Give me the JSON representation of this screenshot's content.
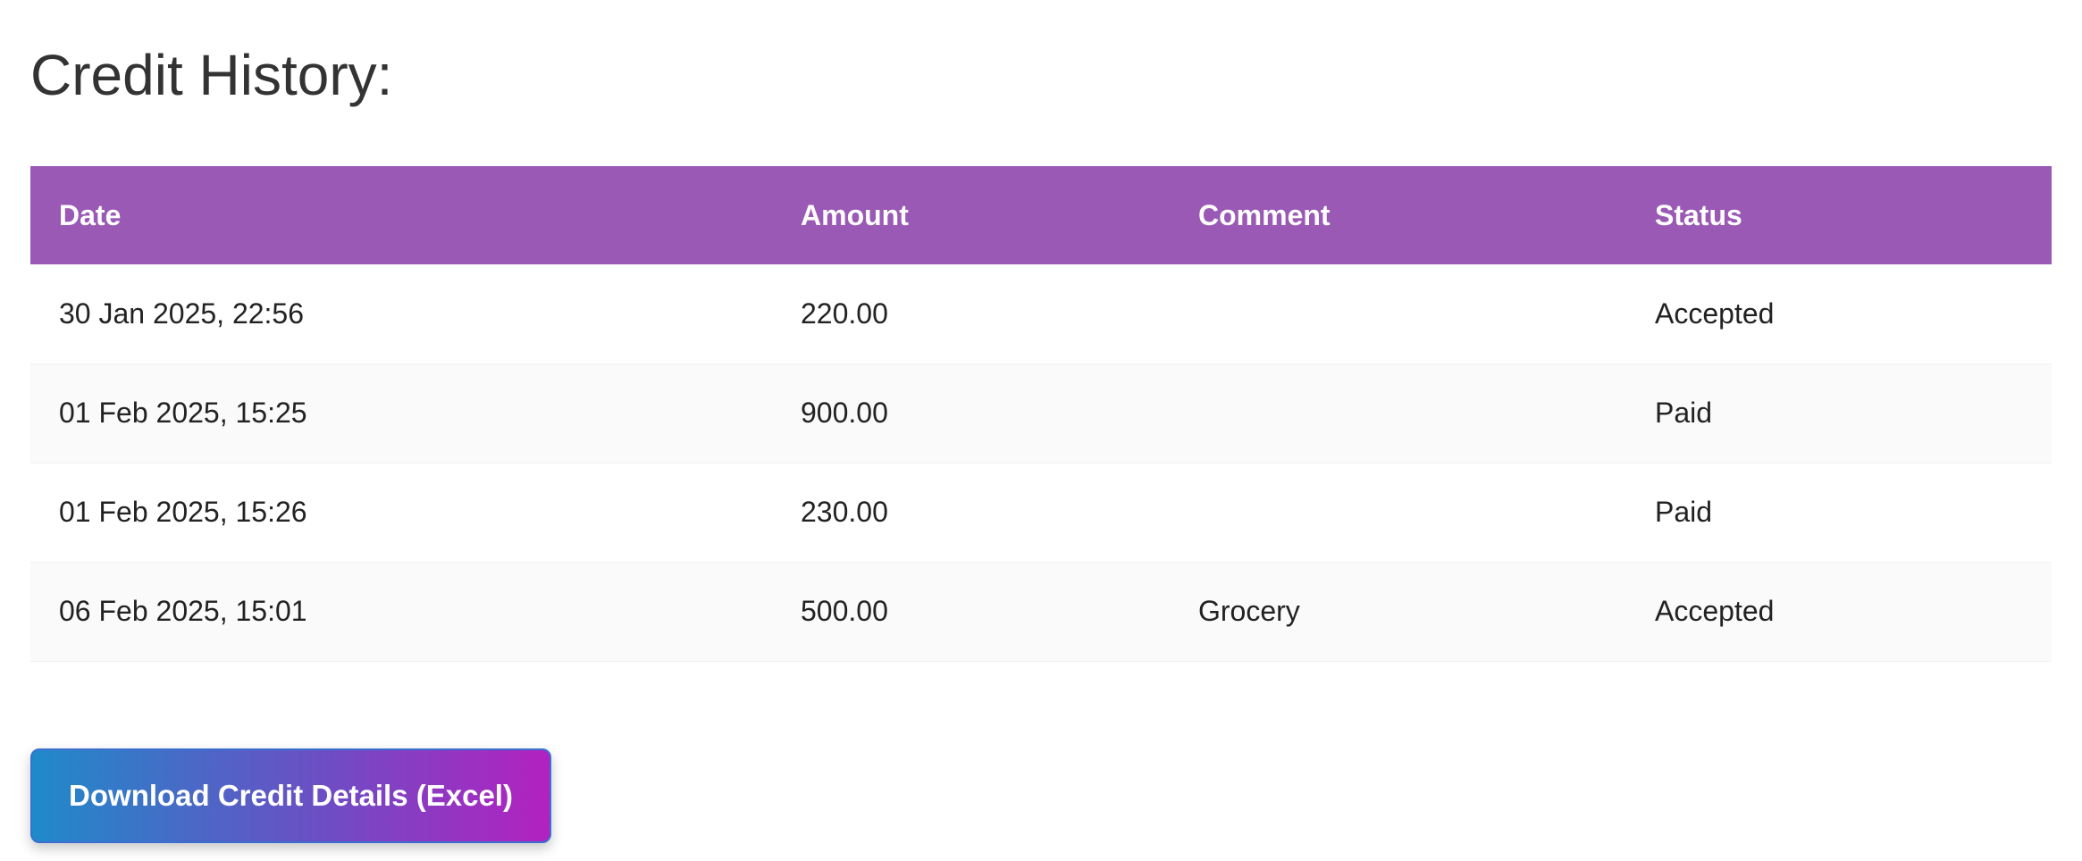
{
  "page": {
    "title": "Credit History:"
  },
  "table": {
    "headers": [
      "Date",
      "Amount",
      "Comment",
      "Status"
    ],
    "rows": [
      {
        "date": "30 Jan 2025, 22:56",
        "amount": "220.00",
        "comment": "",
        "status": "Accepted"
      },
      {
        "date": "01 Feb 2025, 15:25",
        "amount": "900.00",
        "comment": "",
        "status": "Paid"
      },
      {
        "date": "01 Feb 2025, 15:26",
        "amount": "230.00",
        "comment": "",
        "status": "Paid"
      },
      {
        "date": "06 Feb 2025, 15:01",
        "amount": "500.00",
        "comment": "Grocery",
        "status": "Accepted"
      }
    ]
  },
  "actions": {
    "download_label": "Download Credit Details (Excel)"
  },
  "colors": {
    "header_bg": "#9b59b6",
    "button_gradient_start": "#1f8ac9",
    "button_gradient_end": "#b321c0"
  }
}
